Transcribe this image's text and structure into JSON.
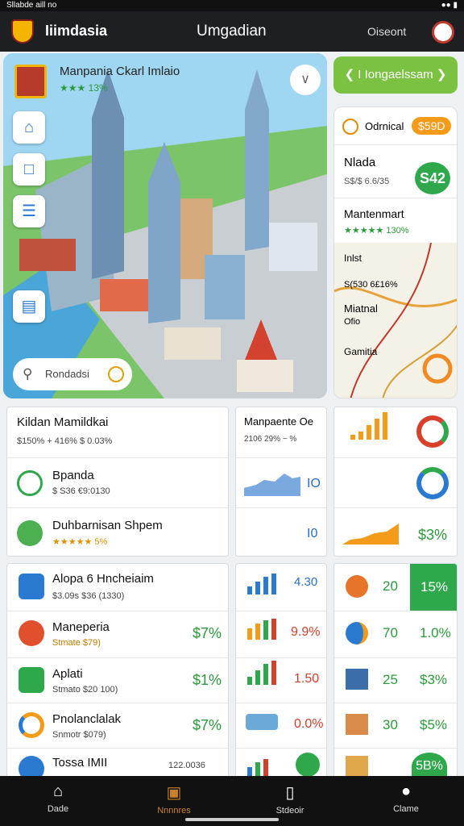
{
  "status": {
    "left": "Sllabde aill no"
  },
  "header": {
    "app_name": "Iiimdasia",
    "title": "Umgadian",
    "account": "Oiseont"
  },
  "map": {
    "title": "Manpania Ckarl Imlaio",
    "subtitle": "★★★  13%",
    "search_placeholder": "Rondadsi"
  },
  "right_panel": {
    "top_button": "❮ I  Iongaelssam ❯",
    "items": [
      {
        "label": "Odrnical",
        "badge": "$59D"
      },
      {
        "label": "Nlada",
        "sub": "S$/$ 6.6/35",
        "badge": "S42"
      },
      {
        "label": "Mantenmart",
        "sub": "★★★★★  130%"
      },
      {
        "label": "Inlst",
        "sub": "S(530 6£16%"
      },
      {
        "label": "Miatnal",
        "sub": "Ofio"
      },
      {
        "label": "Gamitia"
      }
    ]
  },
  "cards_row1": {
    "c1": {
      "title": "Kildan Mamildkai",
      "sub": "$150%  + 416%  $ 0.03%"
    },
    "c2": {
      "title": "Bpanda",
      "sub": "$ S36 €9:0130"
    },
    "c3": {
      "title": "Duhbarnisan Shpem",
      "sub": "★★★★★ 5%"
    },
    "mid": {
      "title": "Manpaente Oe",
      "sub": "2106  29% − %",
      "v1": "IO",
      "v2": "I0"
    },
    "right": {
      "v3": "$3%"
    }
  },
  "cards_row2": {
    "list": [
      {
        "title": "Alopa 6 Hncheiaim",
        "sub": "$3.09s  $36  (1330)"
      },
      {
        "title": "Maneperia",
        "sub": "Stmate $79)",
        "val": "$7%"
      },
      {
        "title": "Aplati",
        "sub": "Stmato $20 100)",
        "val": "$1%"
      },
      {
        "title": "Pnolanclalak",
        "sub": "Snmotr $079)",
        "val": "$7%"
      },
      {
        "title": "Tossa IMII",
        "sub": "122.0036"
      }
    ],
    "mid": [
      {
        "v": "4.30"
      },
      {
        "v": "9.9%"
      },
      {
        "v": "1.50"
      },
      {
        "v": "0.0%"
      }
    ],
    "right": [
      {
        "n": "20",
        "v": "15%"
      },
      {
        "n": "70",
        "v": "1.0%"
      },
      {
        "n": "25",
        "v": "$3%"
      },
      {
        "n": "30",
        "v": "$5%"
      },
      {
        "v": "5B%"
      }
    ]
  },
  "nav": [
    {
      "label": "Dade"
    },
    {
      "label": "Nnnnres"
    },
    {
      "label": "Stdeoir"
    },
    {
      "label": "Clame"
    }
  ]
}
